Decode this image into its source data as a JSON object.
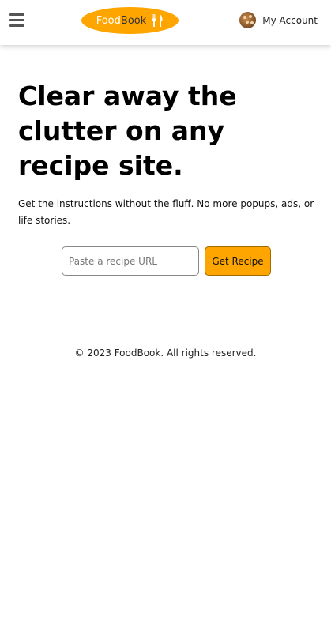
{
  "header": {
    "logo": {
      "part1": "Food",
      "part2": "Book",
      "icon": "fork-knife-icon",
      "color": "#ffa500"
    },
    "menu_icon": "hamburger-icon",
    "account": {
      "label": "My Account",
      "avatar": "avatar"
    }
  },
  "hero": {
    "title": "Clear away the clutter on any recipe site.",
    "subtitle": "Get the instructions without the fluff. No more popups, ads, or life stories."
  },
  "search": {
    "placeholder": "Paste a recipe URL",
    "value": "",
    "button_label": "Get Recipe"
  },
  "footer": {
    "copyright": "© 2023 FoodBook. All rights reserved."
  }
}
